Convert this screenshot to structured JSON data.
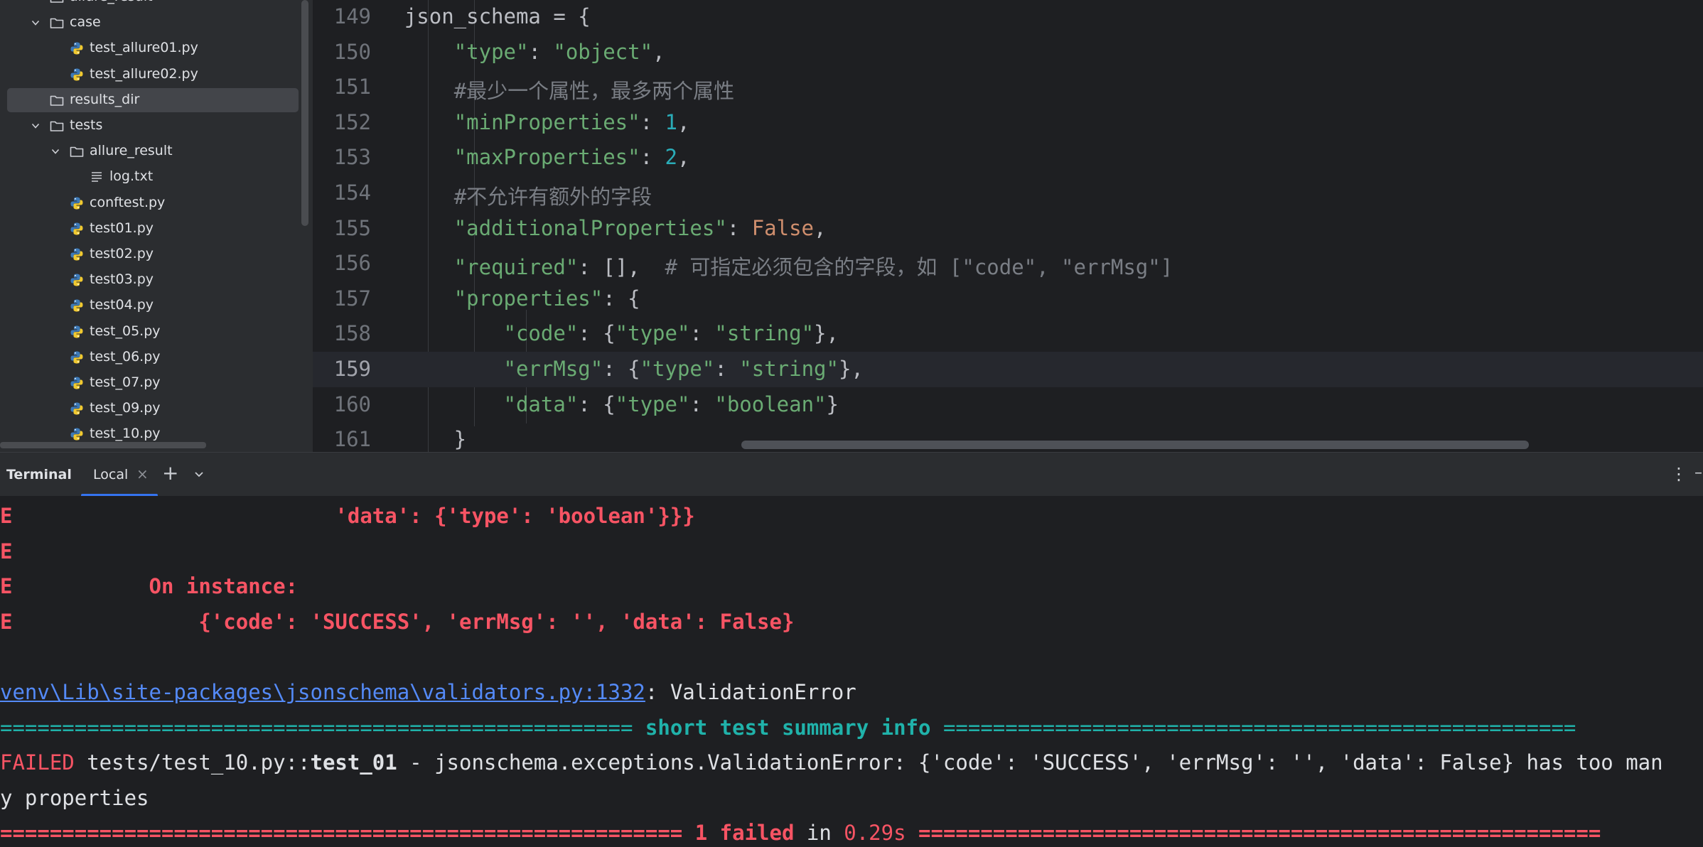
{
  "project_tree": {
    "items": [
      {
        "label": "allure_result",
        "type": "folder",
        "indent": 1,
        "expanded": false,
        "selected": false
      },
      {
        "label": "case",
        "type": "folder",
        "indent": 1,
        "expanded": true,
        "selected": false
      },
      {
        "label": "test_allure01.py",
        "type": "python",
        "indent": 2,
        "expanded": false,
        "selected": false
      },
      {
        "label": "test_allure02.py",
        "type": "python",
        "indent": 2,
        "expanded": false,
        "selected": false
      },
      {
        "label": "results_dir",
        "type": "folder",
        "indent": 1,
        "expanded": false,
        "selected": true
      },
      {
        "label": "tests",
        "type": "folder",
        "indent": 1,
        "expanded": true,
        "selected": false
      },
      {
        "label": "allure_result",
        "type": "folder",
        "indent": 2,
        "expanded": true,
        "selected": false
      },
      {
        "label": "log.txt",
        "type": "text",
        "indent": 3,
        "expanded": false,
        "selected": false
      },
      {
        "label": "conftest.py",
        "type": "python",
        "indent": 2,
        "expanded": false,
        "selected": false
      },
      {
        "label": "test01.py",
        "type": "python",
        "indent": 2,
        "expanded": false,
        "selected": false
      },
      {
        "label": "test02.py",
        "type": "python",
        "indent": 2,
        "expanded": false,
        "selected": false
      },
      {
        "label": "test03.py",
        "type": "python",
        "indent": 2,
        "expanded": false,
        "selected": false
      },
      {
        "label": "test04.py",
        "type": "python",
        "indent": 2,
        "expanded": false,
        "selected": false
      },
      {
        "label": "test_05.py",
        "type": "python",
        "indent": 2,
        "expanded": false,
        "selected": false
      },
      {
        "label": "test_06.py",
        "type": "python",
        "indent": 2,
        "expanded": false,
        "selected": false
      },
      {
        "label": "test_07.py",
        "type": "python",
        "indent": 2,
        "expanded": false,
        "selected": false
      },
      {
        "label": "test_09.py",
        "type": "python",
        "indent": 2,
        "expanded": false,
        "selected": false
      },
      {
        "label": "test_10.py",
        "type": "python",
        "indent": 2,
        "expanded": false,
        "selected": false
      }
    ]
  },
  "editor": {
    "current_line": 159,
    "lines": [
      {
        "num": "149",
        "tokens": [
          [
            "p",
            "    json_schema = {"
          ]
        ]
      },
      {
        "num": "150",
        "tokens": [
          [
            "p",
            "        "
          ],
          [
            "s",
            "\"type\""
          ],
          [
            "p",
            ": "
          ],
          [
            "s",
            "\"object\""
          ],
          [
            "p",
            ","
          ]
        ]
      },
      {
        "num": "151",
        "tokens": [
          [
            "p",
            "        "
          ],
          [
            "c",
            "#最少一个属性，最多两个属性"
          ]
        ]
      },
      {
        "num": "152",
        "tokens": [
          [
            "p",
            "        "
          ],
          [
            "s",
            "\"minProperties\""
          ],
          [
            "p",
            ": "
          ],
          [
            "n",
            "1"
          ],
          [
            "p",
            ","
          ]
        ]
      },
      {
        "num": "153",
        "tokens": [
          [
            "p",
            "        "
          ],
          [
            "s",
            "\"maxProperties\""
          ],
          [
            "p",
            ": "
          ],
          [
            "n",
            "2"
          ],
          [
            "p",
            ","
          ]
        ]
      },
      {
        "num": "154",
        "tokens": [
          [
            "p",
            "        "
          ],
          [
            "c",
            "#不允许有额外的字段"
          ]
        ]
      },
      {
        "num": "155",
        "tokens": [
          [
            "p",
            "        "
          ],
          [
            "s",
            "\"additionalProperties\""
          ],
          [
            "p",
            ": "
          ],
          [
            "k",
            "False"
          ],
          [
            "p",
            ","
          ]
        ]
      },
      {
        "num": "156",
        "tokens": [
          [
            "p",
            "        "
          ],
          [
            "s",
            "\"required\""
          ],
          [
            "p",
            ": [],  "
          ],
          [
            "c",
            "# 可指定必须包含的字段，如 [\"code\", \"errMsg\"]"
          ]
        ]
      },
      {
        "num": "157",
        "tokens": [
          [
            "p",
            "        "
          ],
          [
            "s",
            "\"properties\""
          ],
          [
            "p",
            ": {"
          ]
        ]
      },
      {
        "num": "158",
        "tokens": [
          [
            "p",
            "            "
          ],
          [
            "s",
            "\"code\""
          ],
          [
            "p",
            ": {"
          ],
          [
            "s",
            "\"type\""
          ],
          [
            "p",
            ": "
          ],
          [
            "s",
            "\"string\""
          ],
          [
            "p",
            "},"
          ]
        ]
      },
      {
        "num": "159",
        "tokens": [
          [
            "p",
            "            "
          ],
          [
            "s",
            "\"errMsg\""
          ],
          [
            "p",
            ": {"
          ],
          [
            "s",
            "\"type\""
          ],
          [
            "p",
            ": "
          ],
          [
            "s",
            "\"string\""
          ],
          [
            "p",
            "},"
          ]
        ]
      },
      {
        "num": "160",
        "tokens": [
          [
            "p",
            "            "
          ],
          [
            "s",
            "\"data\""
          ],
          [
            "p",
            ": {"
          ],
          [
            "s",
            "\"type\""
          ],
          [
            "p",
            ": "
          ],
          [
            "s",
            "\"boolean\""
          ],
          [
            "p",
            "}"
          ]
        ]
      },
      {
        "num": "161",
        "tokens": [
          [
            "p",
            "        }"
          ]
        ]
      }
    ]
  },
  "terminal_header": {
    "title": "Terminal",
    "tab_label": "Local",
    "close_glyph": "×",
    "plus_glyph": "+",
    "more_glyph": "⋮",
    "minimize_glyph": "–"
  },
  "terminal": {
    "lines": [
      [
        [
          "red",
          "E                          'data': {'type': 'boolean'}}}"
        ]
      ],
      [
        [
          "red",
          "E"
        ]
      ],
      [
        [
          "red",
          "E           On instance:"
        ]
      ],
      [
        [
          "red",
          "E               {'code': 'SUCCESS', 'errMsg': '', 'data': False}"
        ]
      ],
      [
        [
          "p",
          ""
        ]
      ],
      [
        [
          "link",
          "venv\\Lib\\site-packages\\jsonschema\\validators.py:1332"
        ],
        [
          "p",
          ": ValidationError"
        ]
      ],
      [
        [
          "cyan",
          "=================================================== "
        ],
        [
          "cyanb",
          "short test summary info"
        ],
        [
          "cyan",
          " ==================================================="
        ]
      ],
      [
        [
          "redn",
          "FAILED"
        ],
        [
          "p",
          " tests/test_10.py::"
        ],
        [
          "bold",
          "test_01"
        ],
        [
          "p",
          " - jsonschema.exceptions.ValidationError: {'code': 'SUCCESS', 'errMsg': '', 'data': False} has too man"
        ]
      ],
      [
        [
          "p",
          "y properties"
        ]
      ],
      [
        [
          "red",
          "======================================================= "
        ],
        [
          "red",
          "1 failed"
        ],
        [
          "p",
          " in "
        ],
        [
          "redn",
          "0.29s"
        ],
        [
          "red",
          " ======================================================="
        ]
      ]
    ]
  },
  "colors": {
    "background": "#1e1f22",
    "panel": "#2b2d30",
    "selection": "#43454a",
    "string": "#6aab73",
    "keyword": "#cf8e6d",
    "number": "#2aacb8",
    "comment": "#7a7e85",
    "error": "#f75464",
    "info": "#20b2aa",
    "link": "#548af7",
    "accent": "#3574f0"
  }
}
